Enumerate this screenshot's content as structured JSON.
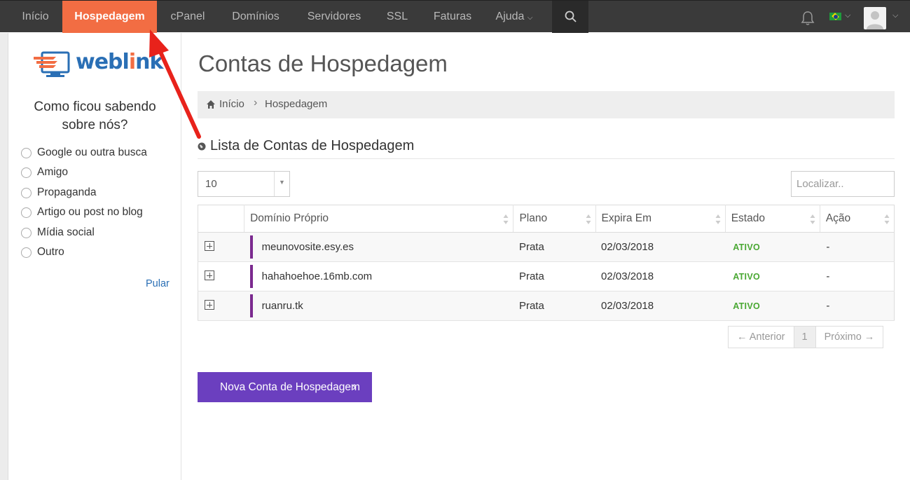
{
  "nav": {
    "items": [
      {
        "label": "Início"
      },
      {
        "label": "Hospedagem"
      },
      {
        "label": "cPanel"
      },
      {
        "label": "Domínios"
      },
      {
        "label": "Servidores"
      },
      {
        "label": "SSL"
      },
      {
        "label": "Faturas"
      },
      {
        "label": "Ajuda"
      }
    ],
    "active": "Hospedagem",
    "active_color": "#f26d43",
    "icons": [
      "search-icon",
      "bell-icon",
      "brazil-flag-icon",
      "avatar-icon"
    ]
  },
  "sidebar": {
    "logo_text_a": "webl",
    "logo_text_b": "i",
    "logo_text_c": "nk",
    "survey_title": "Como ficou sabendo sobre nós?",
    "options": [
      {
        "label": "Google ou outra busca"
      },
      {
        "label": "Amigo"
      },
      {
        "label": "Propaganda"
      },
      {
        "label": "Artigo ou post no blog"
      },
      {
        "label": "Mídia social"
      },
      {
        "label": "Outro"
      }
    ],
    "skip_label": "Pular"
  },
  "main": {
    "title": "Contas de Hospedagem",
    "breadcrumb": [
      "Início",
      "Hospedagem"
    ],
    "section_title": "Lista de Contas de Hospedagem",
    "page_length": "10",
    "search_placeholder": "Localizar..",
    "table": {
      "headers": [
        "Domínio Próprio",
        "Plano",
        "Expira Em",
        "Estado",
        "Ação"
      ],
      "rows": [
        {
          "domain": "meunovosite.esy.es",
          "plan": "Prata",
          "expires": "02/03/2018",
          "status": "ATIVO",
          "action": "-"
        },
        {
          "domain": "hahahoehoe.16mb.com",
          "plan": "Prata",
          "expires": "02/03/2018",
          "status": "ATIVO",
          "action": "-"
        },
        {
          "domain": "ruanru.tk",
          "plan": "Prata",
          "expires": "02/03/2018",
          "status": "ATIVO",
          "action": "-"
        }
      ]
    },
    "pagination": {
      "prev": "← Anterior",
      "page": "1",
      "next": "Próximo →"
    },
    "new_button": "Nova Conta de Hospedagem",
    "button_color": "#6b3fbf",
    "status_color": "#4aa833"
  }
}
